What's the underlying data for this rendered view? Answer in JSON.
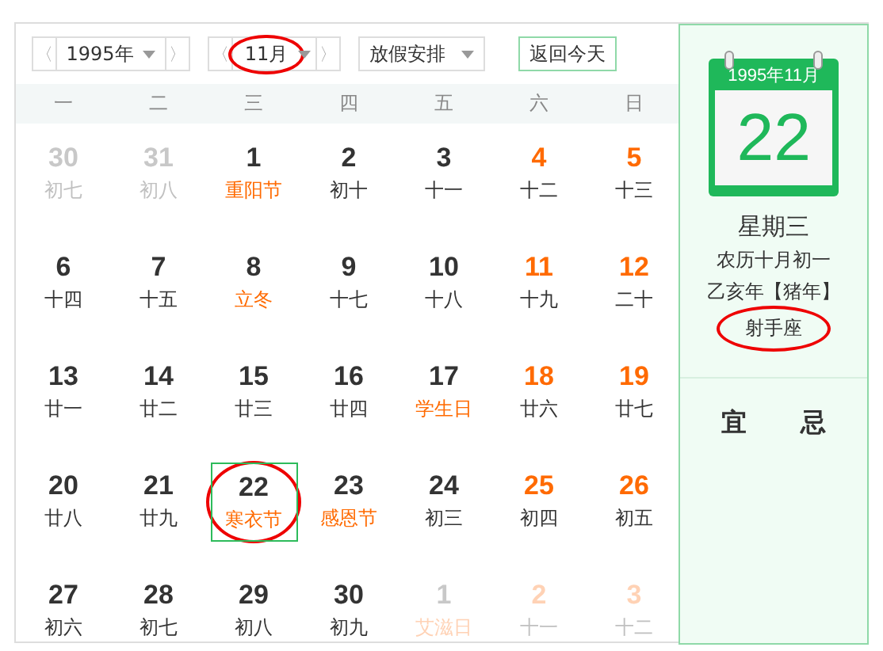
{
  "toolbar": {
    "year": {
      "label": "1995年",
      "prev": "〈",
      "next": "〉"
    },
    "month": {
      "label": "11月",
      "prev": "〈",
      "next": "〉",
      "circled": true
    },
    "holiday": {
      "label": "放假安排"
    },
    "today_button": "返回今天"
  },
  "weekdays": [
    "一",
    "二",
    "三",
    "四",
    "五",
    "六",
    "日"
  ],
  "days": [
    {
      "day": "30",
      "lunar": "初七",
      "in_month": false,
      "weekend": false,
      "festival": false,
      "selected": false,
      "circled": false
    },
    {
      "day": "31",
      "lunar": "初八",
      "in_month": false,
      "weekend": false,
      "festival": false,
      "selected": false,
      "circled": false
    },
    {
      "day": "1",
      "lunar": "重阳节",
      "in_month": true,
      "weekend": false,
      "festival": true,
      "selected": false,
      "circled": false
    },
    {
      "day": "2",
      "lunar": "初十",
      "in_month": true,
      "weekend": false,
      "festival": false,
      "selected": false,
      "circled": false
    },
    {
      "day": "3",
      "lunar": "十一",
      "in_month": true,
      "weekend": false,
      "festival": false,
      "selected": false,
      "circled": false
    },
    {
      "day": "4",
      "lunar": "十二",
      "in_month": true,
      "weekend": true,
      "festival": false,
      "selected": false,
      "circled": false
    },
    {
      "day": "5",
      "lunar": "十三",
      "in_month": true,
      "weekend": true,
      "festival": false,
      "selected": false,
      "circled": false
    },
    {
      "day": "6",
      "lunar": "十四",
      "in_month": true,
      "weekend": false,
      "festival": false,
      "selected": false,
      "circled": false
    },
    {
      "day": "7",
      "lunar": "十五",
      "in_month": true,
      "weekend": false,
      "festival": false,
      "selected": false,
      "circled": false
    },
    {
      "day": "8",
      "lunar": "立冬",
      "in_month": true,
      "weekend": false,
      "festival": true,
      "selected": false,
      "circled": false
    },
    {
      "day": "9",
      "lunar": "十七",
      "in_month": true,
      "weekend": false,
      "festival": false,
      "selected": false,
      "circled": false
    },
    {
      "day": "10",
      "lunar": "十八",
      "in_month": true,
      "weekend": false,
      "festival": false,
      "selected": false,
      "circled": false
    },
    {
      "day": "11",
      "lunar": "十九",
      "in_month": true,
      "weekend": true,
      "festival": false,
      "selected": false,
      "circled": false
    },
    {
      "day": "12",
      "lunar": "二十",
      "in_month": true,
      "weekend": true,
      "festival": false,
      "selected": false,
      "circled": false
    },
    {
      "day": "13",
      "lunar": "廿一",
      "in_month": true,
      "weekend": false,
      "festival": false,
      "selected": false,
      "circled": false
    },
    {
      "day": "14",
      "lunar": "廿二",
      "in_month": true,
      "weekend": false,
      "festival": false,
      "selected": false,
      "circled": false
    },
    {
      "day": "15",
      "lunar": "廿三",
      "in_month": true,
      "weekend": false,
      "festival": false,
      "selected": false,
      "circled": false
    },
    {
      "day": "16",
      "lunar": "廿四",
      "in_month": true,
      "weekend": false,
      "festival": false,
      "selected": false,
      "circled": false
    },
    {
      "day": "17",
      "lunar": "学生日",
      "in_month": true,
      "weekend": false,
      "festival": true,
      "selected": false,
      "circled": false
    },
    {
      "day": "18",
      "lunar": "廿六",
      "in_month": true,
      "weekend": true,
      "festival": false,
      "selected": false,
      "circled": false
    },
    {
      "day": "19",
      "lunar": "廿七",
      "in_month": true,
      "weekend": true,
      "festival": false,
      "selected": false,
      "circled": false
    },
    {
      "day": "20",
      "lunar": "廿八",
      "in_month": true,
      "weekend": false,
      "festival": false,
      "selected": false,
      "circled": false
    },
    {
      "day": "21",
      "lunar": "廿九",
      "in_month": true,
      "weekend": false,
      "festival": false,
      "selected": false,
      "circled": false
    },
    {
      "day": "22",
      "lunar": "寒衣节",
      "in_month": true,
      "weekend": false,
      "festival": true,
      "selected": true,
      "circled": true
    },
    {
      "day": "23",
      "lunar": "感恩节",
      "in_month": true,
      "weekend": false,
      "festival": true,
      "selected": false,
      "circled": false
    },
    {
      "day": "24",
      "lunar": "初三",
      "in_month": true,
      "weekend": false,
      "festival": false,
      "selected": false,
      "circled": false
    },
    {
      "day": "25",
      "lunar": "初四",
      "in_month": true,
      "weekend": true,
      "festival": false,
      "selected": false,
      "circled": false
    },
    {
      "day": "26",
      "lunar": "初五",
      "in_month": true,
      "weekend": true,
      "festival": false,
      "selected": false,
      "circled": false
    },
    {
      "day": "27",
      "lunar": "初六",
      "in_month": true,
      "weekend": false,
      "festival": false,
      "selected": false,
      "circled": false
    },
    {
      "day": "28",
      "lunar": "初七",
      "in_month": true,
      "weekend": false,
      "festival": false,
      "selected": false,
      "circled": false
    },
    {
      "day": "29",
      "lunar": "初八",
      "in_month": true,
      "weekend": false,
      "festival": false,
      "selected": false,
      "circled": false
    },
    {
      "day": "30",
      "lunar": "初九",
      "in_month": true,
      "weekend": false,
      "festival": false,
      "selected": false,
      "circled": false
    },
    {
      "day": "1",
      "lunar": "艾滋日",
      "in_month": false,
      "weekend": false,
      "festival": true,
      "selected": false,
      "circled": false
    },
    {
      "day": "2",
      "lunar": "十一",
      "in_month": false,
      "weekend": true,
      "festival": false,
      "selected": false,
      "circled": false
    },
    {
      "day": "3",
      "lunar": "十二",
      "in_month": false,
      "weekend": true,
      "festival": false,
      "selected": false,
      "circled": false
    }
  ],
  "side": {
    "header": "1995年11月",
    "day": "22",
    "weekday": "星期三",
    "lunar_date": "农历十月初一",
    "ganzhi": "乙亥年【猪年】",
    "zodiac": {
      "text": "射手座",
      "circled": true
    },
    "good": "宜",
    "bad": "忌"
  }
}
